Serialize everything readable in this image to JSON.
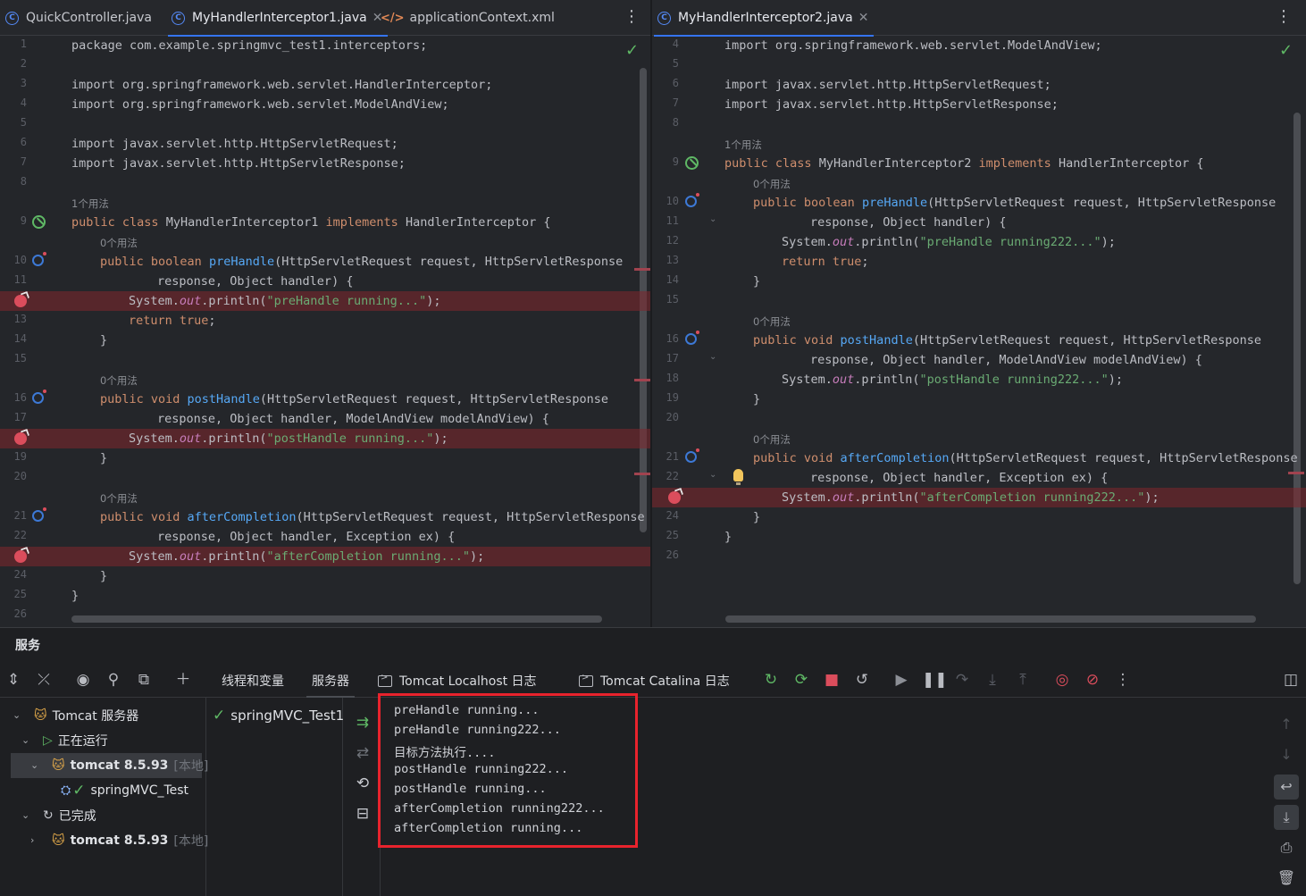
{
  "left_pane": {
    "tabs": [
      {
        "label": "QuickController.java",
        "icon": "java-class-icon"
      },
      {
        "label": "MyHandlerInterceptor1.java",
        "icon": "java-class-icon",
        "active": true
      },
      {
        "label": "applicationContext.xml",
        "icon": "xml-file-icon"
      }
    ],
    "more": "⋮",
    "status_icon": "inspection-ok-icon"
  },
  "right_pane": {
    "tabs": [
      {
        "label": "MyHandlerInterceptor2.java",
        "icon": "java-class-icon",
        "active": true
      }
    ],
    "more": "⋮",
    "status_icon": "inspection-ok-icon"
  },
  "left_code": {
    "ln": [
      "1",
      "2",
      "3",
      "4",
      "5",
      "6",
      "7",
      "8",
      "9",
      "10",
      "11",
      "",
      "13",
      "14",
      "15",
      "16",
      "17",
      "",
      "19",
      "20",
      "21",
      "22",
      "",
      "24",
      "25",
      "26"
    ],
    "l1": "package com.example.springmvc_test1.interceptors;",
    "l3": "import org.springframework.web.servlet.HandlerInterceptor;",
    "l4": "import org.springframework.web.servlet.ModelAndView;",
    "l6": "import javax.servlet.http.HttpServletRequest;",
    "l7": "import javax.servlet.http.HttpServletResponse;",
    "usage_class": "1个用法",
    "class_decl": {
      "kw": "public class",
      "name": "MyHandlerInterceptor1",
      "impl": "implements",
      "rest": "HandlerInterceptor {"
    },
    "usage_pre": "0个用法",
    "pre_kw": "public boolean",
    "pre_fn": "preHandle",
    "pre_args": "(HttpServletRequest request, HttpServletResponse",
    "pre_args2": "response, Object handler) {",
    "pre_body_a": "System.",
    "pre_body_out": "out",
    "pre_body_b": ".println(",
    "pre_body_str": "\"preHandle running...\"",
    "pre_body_c": ");",
    "ret_kw": "return true",
    "ret_end": ";",
    "close1": "}",
    "usage_post": "0个用法",
    "post_kw": "public void",
    "post_fn": "postHandle",
    "post_args": "(HttpServletRequest request, HttpServletResponse",
    "post_args2": "response, Object handler, ModelAndView modelAndView) {",
    "post_body_str": "\"postHandle running...\"",
    "close2": "}",
    "usage_after": "0个用法",
    "after_kw": "public void",
    "after_fn": "afterCompletion",
    "after_args": "(HttpServletRequest request, HttpServletResponse",
    "after_args2": "response, Object handler, Exception ex) {",
    "after_body_str": "\"afterCompletion running...\"",
    "close3": "}",
    "close4": "}"
  },
  "right_code": {
    "ln": [
      "4",
      "5",
      "6",
      "7",
      "8",
      "9",
      "10",
      "11",
      "12",
      "13",
      "14",
      "15",
      "16",
      "17",
      "18",
      "19",
      "20",
      "21",
      "22",
      "",
      "24",
      "25",
      "26"
    ],
    "l4": "import org.springframework.web.servlet.ModelAndView;",
    "l6": "import javax.servlet.http.HttpServletRequest;",
    "l7": "import javax.servlet.http.HttpServletResponse;",
    "usage_class": "1个用法",
    "class_kw": "public class",
    "class_name": "MyHandlerInterceptor2",
    "class_impl": "implements",
    "class_rest": "HandlerInterceptor {",
    "usage_pre": "0个用法",
    "pre_kw": "public boolean",
    "pre_fn": "preHandle",
    "pre_args": "(HttpServletRequest request, HttpServletResponse",
    "pre_args2": "response, Object handler) {",
    "pre_body_str": "\"preHandle running222...\"",
    "ret_kw": "return true",
    "ret_end": ";",
    "close1": "}",
    "usage_post": "0个用法",
    "post_kw": "public void",
    "post_fn": "postHandle",
    "post_args": "(HttpServletRequest request, HttpServletResponse",
    "post_args2": "response, Object handler, ModelAndView modelAndView) {",
    "post_body_str": "\"postHandle running222...\"",
    "close2": "}",
    "usage_after": "0个用法",
    "after_kw": "public void",
    "after_fn": "afterCompletion",
    "after_args": "(HttpServletRequest request, HttpServletResponse",
    "after_args2": "response, Object handler, Exception ex) {",
    "after_body_str": "\"afterCompletion running222...\"",
    "close3": "}",
    "close4": "}"
  },
  "services": {
    "title": "服务",
    "tabs": [
      "线程和变量",
      "服务器",
      "Tomcat Localhost 日志",
      "Tomcat Catalina 日志"
    ],
    "active_tab": "服务器",
    "tree": {
      "root": "Tomcat 服务器",
      "running": "正在运行",
      "server1": "tomcat 8.5.93",
      "server1_loc": "[本地]",
      "artifact": "springMVC_Test",
      "finished": "已完成",
      "server2": "tomcat 8.5.93",
      "server2_loc": "[本地]"
    },
    "deployment": "springMVC_Test1",
    "console": [
      "preHandle running...",
      "preHandle running222...",
      "目标方法执行....",
      "postHandle running222...",
      "postHandle running...",
      "afterCompletion running222...",
      "afterCompletion running..."
    ],
    "highlight_color": "#e8232d"
  }
}
